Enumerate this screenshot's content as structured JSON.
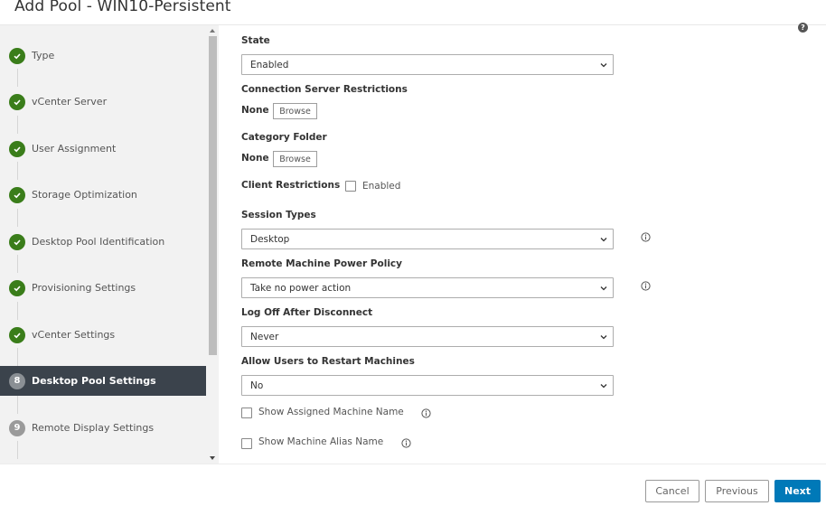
{
  "header": {
    "title": "Add Pool - WIN10-Persistent"
  },
  "sidebar": {
    "steps": [
      {
        "label": "Type",
        "status": "complete",
        "icon": "check-circle-icon"
      },
      {
        "label": "vCenter Server",
        "status": "complete",
        "icon": "check-circle-icon"
      },
      {
        "label": "User Assignment",
        "status": "complete",
        "icon": "check-circle-icon"
      },
      {
        "label": "Storage Optimization",
        "status": "complete",
        "icon": "check-circle-icon"
      },
      {
        "label": "Desktop Pool Identification",
        "status": "complete",
        "icon": "check-circle-icon"
      },
      {
        "label": "Provisioning Settings",
        "status": "complete",
        "icon": "check-circle-icon"
      },
      {
        "label": "vCenter Settings",
        "status": "complete",
        "icon": "check-circle-icon"
      },
      {
        "label": "Desktop Pool Settings",
        "status": "active",
        "number": "8"
      },
      {
        "label": "Remote Display Settings",
        "status": "pending",
        "number": "9"
      }
    ]
  },
  "form": {
    "help_icon": "?",
    "state": {
      "label": "State",
      "value": "Enabled"
    },
    "connection_server_restrictions": {
      "label": "Connection Server Restrictions",
      "value": "None",
      "button": "Browse"
    },
    "category_folder": {
      "label": "Category Folder",
      "value": "None",
      "button": "Browse"
    },
    "client_restrictions": {
      "label": "Client Restrictions",
      "checkbox_label": "Enabled",
      "checked": false
    },
    "session_types": {
      "label": "Session Types",
      "value": "Desktop"
    },
    "power_policy": {
      "label": "Remote Machine Power Policy",
      "value": "Take no power action"
    },
    "log_off": {
      "label": "Log Off After Disconnect",
      "value": "Never"
    },
    "allow_restart": {
      "label": "Allow Users to Restart Machines",
      "value": "No"
    },
    "show_assigned_machine_name": {
      "label": "Show Assigned Machine Name",
      "checked": false
    },
    "show_machine_alias_name": {
      "label": "Show Machine Alias Name",
      "checked": false
    }
  },
  "footer": {
    "cancel": "Cancel",
    "previous": "Previous",
    "next": "Next"
  },
  "colors": {
    "complete": "#3a7d1a",
    "active_bg": "#3b434c",
    "primary": "#0079b8"
  }
}
